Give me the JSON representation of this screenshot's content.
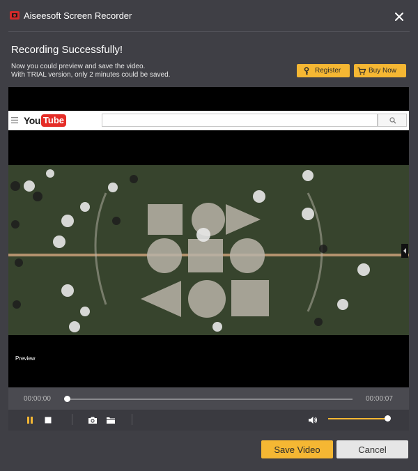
{
  "window": {
    "title": "Aiseesoft Screen Recorder",
    "logo_icon": "recorder-logo-icon",
    "close_icon": "close-icon"
  },
  "header": {
    "heading": "Recording Successfully!",
    "line1": "Now you could preview and save the video.",
    "line2": "With TRIAL version, only 2 minutes could be saved.",
    "register_label": "Register",
    "register_icon": "key-icon",
    "buy_label": "Buy Now",
    "buy_icon": "cart-icon"
  },
  "preview": {
    "youtube_you": "You",
    "youtube_tube": "Tube",
    "label": "Preview"
  },
  "timeline": {
    "current_time": "00:00:00",
    "total_time": "00:00:07",
    "progress": 0
  },
  "controls": {
    "pause_icon": "pause-icon",
    "stop_icon": "stop-icon",
    "snapshot_icon": "camera-icon",
    "folder_icon": "folder-icon",
    "volume_icon": "volume-icon",
    "volume_level": 1.0
  },
  "footer": {
    "save_label": "Save Video",
    "cancel_label": "Cancel"
  },
  "colors": {
    "accent": "#f5b733",
    "background": "#3f3f45",
    "field": "#3c4a31"
  }
}
